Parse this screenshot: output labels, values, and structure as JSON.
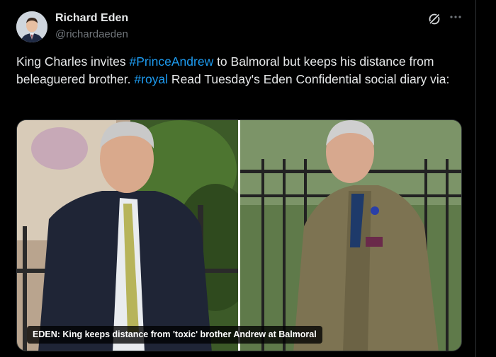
{
  "post": {
    "author_name": "Richard Eden",
    "author_handle": "@richardaeden",
    "text_parts": [
      {
        "text": "King Charles invites ",
        "hashtag": false
      },
      {
        "text": "#PrinceAndrew",
        "hashtag": true
      },
      {
        "text": " to Balmoral but keeps his distance from beleaguered brother. ",
        "hashtag": false
      },
      {
        "text": "#royal",
        "hashtag": true
      },
      {
        "text": " Read Tuesday's Eden Confidential social diary via:",
        "hashtag": false
      }
    ],
    "media_caption": "EDEN: King keeps distance from 'toxic' brother Andrew at Balmoral",
    "media_icons": {
      "grok": "grok-icon",
      "more": "more-icon"
    }
  },
  "colors": {
    "background": "#000000",
    "text": "#e7e9ea",
    "muted": "#71767b",
    "link": "#1d9bf0"
  }
}
